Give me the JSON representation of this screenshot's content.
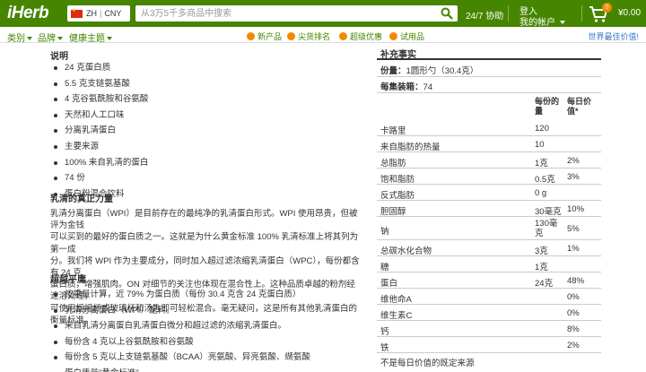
{
  "header": {
    "logo": "iHerb",
    "lang": "ZH",
    "currency": "CNY",
    "search_placeholder": "从3万5千多商品中搜索",
    "support": "24/7 协助",
    "login": "登入",
    "account": "我的帐户",
    "cart_count": "0",
    "cart_total": "¥0.00"
  },
  "nav": {
    "categories": "类别",
    "brands": "品牌",
    "health": "健康主题",
    "promos": [
      "新产品",
      "尖货排名",
      "超级优惠",
      "试用品"
    ],
    "right": "世界最佳价值!"
  },
  "description": {
    "title": "说明",
    "bullets": [
      "24 克蛋白质",
      "5.5 克支链氨基酸",
      "4 克谷氨酰胺和谷氨酸",
      "天然和人工口味",
      "分离乳清蛋白",
      "主要来源",
      "100% 来自乳清的蛋白",
      "74 份",
      "蛋白粉混合饮料"
    ],
    "whey_title": "乳清的真正力量",
    "whey_lines": [
      "乳清分离蛋白（WPI）是目前存在的最纯净的乳清蛋白形式。WPI 使用昂贵，但被评为金钱",
      "可以买到的最好的蛋白质之一。这就是为什么黄金标准 100% 乳清标准上将其列为第一成",
      "分。我们将 WPI 作为主要成分，同时加入超过滤浓缩乳清蛋白（WPC），每份都含有 24 克",
      "蛋白质，增强肌肉。ON 对细节的关注也体现在混合性上。这种品质卓越的粉剂经速溶处理，",
      "可使用摇摇杯或玻璃杯和汤匙即可轻松混合。毫无疑问，这是所有其他乳清蛋白的衡量标准。"
    ],
    "superior_title": "超越平庸",
    "superior_bullets": [
      "按重量计算，近 79% 为蛋白质（每份 30.4 克含 24 克蛋白质）",
      "乳清分离蛋白（WPI）配料。",
      "来自乳清分离蛋白乳清蛋白微分和超过滤的浓缩乳清蛋白。",
      "每份含 4 克以上谷氨酰胺和谷氨酸",
      "每份含 5 克以上支链氨基酸（BCAA）亮氨酸、异亮氨酸、缬氨酸",
      "蛋白质量\"黄金标准\"。"
    ]
  },
  "facts": {
    "title": "补充事实",
    "serving_label": "份量：",
    "serving_value": "1圆形勺（30.4克）",
    "servings_label": "每集装箱：",
    "servings_value": "74",
    "col_amount": [
      "每份的",
      "量"
    ],
    "col_dv": [
      "每日价",
      "值*"
    ],
    "rows": [
      {
        "name": "卡路里",
        "amount": "120",
        "dv": ""
      },
      {
        "name": "来自脂肪的热量",
        "amount": "10",
        "dv": ""
      },
      {
        "name": "总脂肪",
        "amount": "1克",
        "dv": "2%"
      },
      {
        "name": "饱和脂肪",
        "amount": "0.5克",
        "dv": "3%"
      },
      {
        "name": "反式脂肪",
        "amount": "0 g",
        "dv": ""
      },
      {
        "name": "胆固醇",
        "amount": "30毫克",
        "dv": "10%"
      },
      {
        "name": "钠",
        "amount": "130毫\n克",
        "dv": "5%"
      },
      {
        "name": "总碳水化合物",
        "amount": "3克",
        "dv": "1%"
      },
      {
        "name": "糖",
        "amount": "1克",
        "dv": ""
      },
      {
        "name": "蛋白",
        "amount": "24克",
        "dv": "48%"
      },
      {
        "name": "维他命A",
        "amount": "",
        "dv": "0%"
      },
      {
        "name": "维生素C",
        "amount": "",
        "dv": "0%"
      },
      {
        "name": "钙",
        "amount": "",
        "dv": "8%"
      },
      {
        "name": "铁",
        "amount": "",
        "dv": "2%"
      }
    ],
    "footnote": "不是每日价值的既定来源"
  },
  "colors": {
    "brand_green": "#458500",
    "accent_orange": "#f08a00",
    "link_blue": "#3a78c3"
  }
}
